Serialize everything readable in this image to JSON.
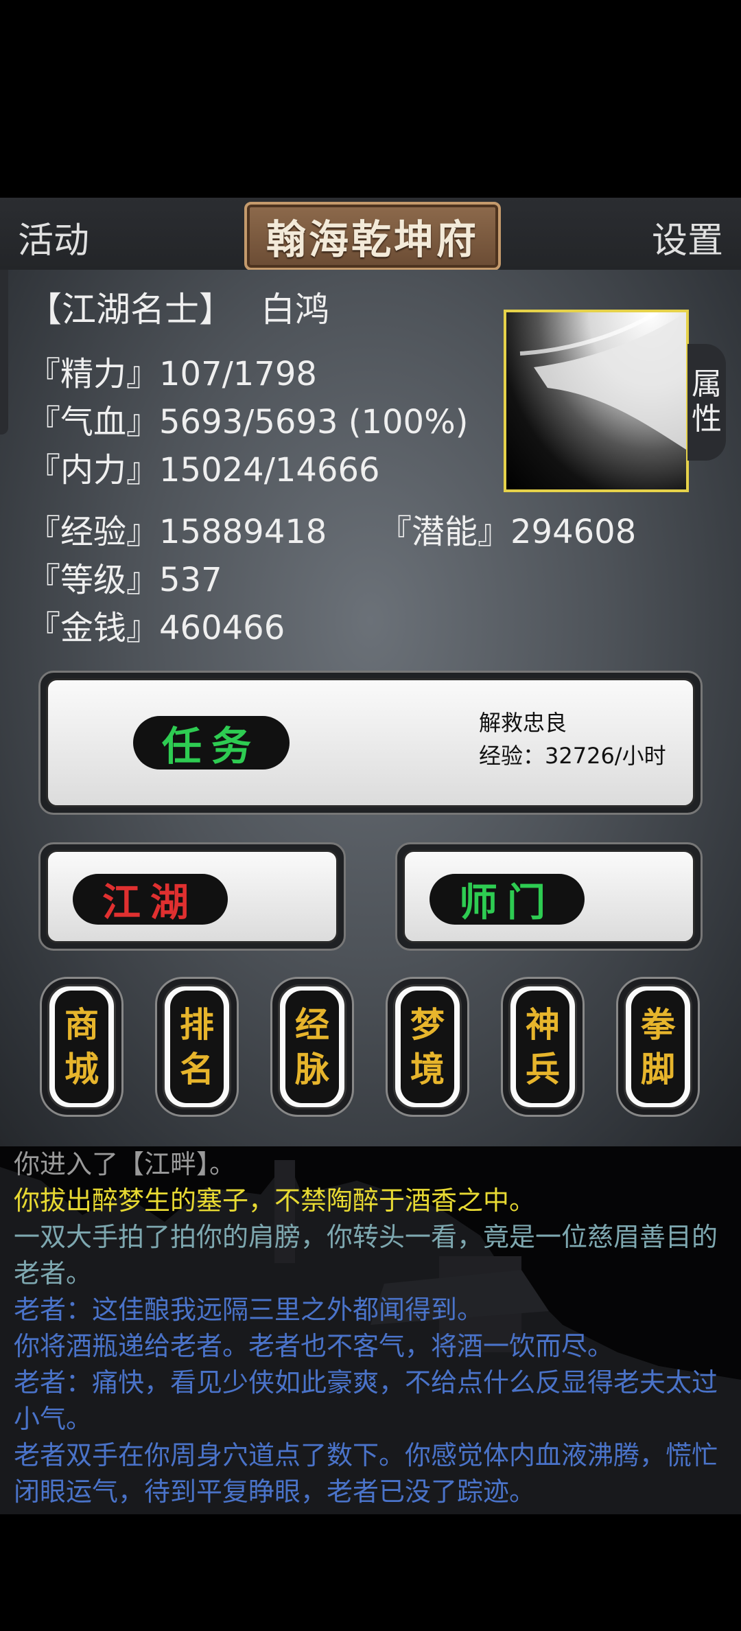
{
  "topbar": {
    "left_label": "活动",
    "title": "翰海乾坤府",
    "right_label": "设置"
  },
  "character": {
    "title": "【江湖名士】",
    "name": "白鸿",
    "stats": {
      "jingli": "『精力』107/1798",
      "qixue": "『气血』5693/5693 (100%)",
      "neili": "『内力』15024/14666",
      "jingyan": "『经验』15889418",
      "qianneng": "『潜能』294608",
      "dengji": "『等级』537",
      "jinqian": "『金钱』460466"
    },
    "attr_tab": [
      "属",
      "性"
    ]
  },
  "task": {
    "label": "任务",
    "name": "解救忠良",
    "exp": "经验：32726/小时"
  },
  "buttons": {
    "jianghu": "江湖",
    "shimen": "师门"
  },
  "menu": [
    {
      "top": "商",
      "bottom": "城"
    },
    {
      "top": "排",
      "bottom": "名"
    },
    {
      "top": "经",
      "bottom": "脉"
    },
    {
      "top": "梦",
      "bottom": "境"
    },
    {
      "top": "神",
      "bottom": "兵"
    },
    {
      "top": "拳",
      "bottom": "脚"
    }
  ],
  "log": [
    "你进入了【江畔】。",
    "你拔出醉梦生的塞子，不禁陶醉于酒香之中。",
    "一双大手拍了拍你的肩膀，你转头一看，竟是一位慈眉善目的老者。",
    "老者：这佳酿我远隔三里之外都闻得到。",
    "你将酒瓶递给老者。老者也不客气，将酒一饮而尽。",
    "老者：痛快，看见少侠如此豪爽，不给点什么反显得老夫太过小气。",
    "老者双手在你周身穴道点了数下。你感觉体内血液沸腾，慌忙闭眼运气，待到平复睁眼，老者已没了踪迹。"
  ],
  "colors": {
    "task_label": "#2ecc52",
    "jianghu_label": "#e03030",
    "shimen_label": "#2ecc52",
    "menu_text": "#e7b52c",
    "portrait_border": "#e6d24a"
  }
}
